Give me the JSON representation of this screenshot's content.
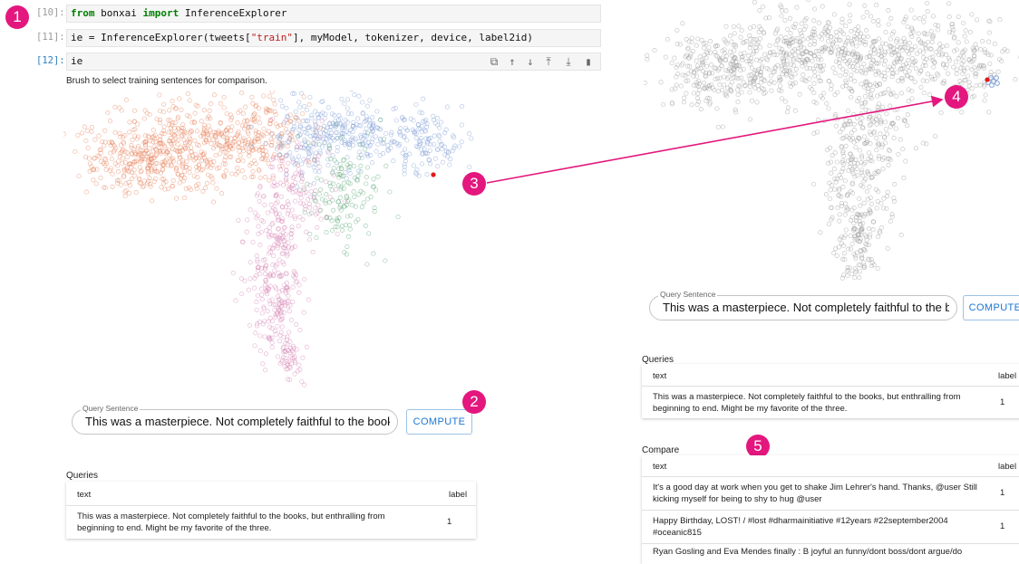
{
  "markers": {
    "m1": "1",
    "m2": "2",
    "m3": "3",
    "m4": "4",
    "m5": "5"
  },
  "cells": [
    {
      "prompt": "[10]:",
      "tokens": [
        {
          "t": "from",
          "c": "kw"
        },
        {
          "t": " bonxai ",
          "c": ""
        },
        {
          "t": "import",
          "c": "kw"
        },
        {
          "t": " InferenceExplorer",
          "c": ""
        }
      ]
    },
    {
      "prompt": "[11]:",
      "tokens": [
        {
          "t": "ie = InferenceExplorer(tweets[",
          "c": ""
        },
        {
          "t": "\"train\"",
          "c": "str"
        },
        {
          "t": "], myModel, tokenizer, device, label2id)",
          "c": ""
        }
      ]
    },
    {
      "prompt": "[12]:",
      "tokens": [
        {
          "t": "ie",
          "c": ""
        }
      ]
    }
  ],
  "toolbar_icons": [
    "copy-icon",
    "arrow-up-icon",
    "arrow-down-icon",
    "insert-above-icon",
    "insert-below-icon",
    "delete-icon"
  ],
  "brush_hint": "Brush to select training sentences for comparison.",
  "left": {
    "query_legend": "Query Sentence",
    "query_value": "This was a masterpiece. Not completely faithful to the books, but en",
    "compute_label": "COMPUTE",
    "queries_label": "Queries",
    "queries_table": {
      "headers": [
        "text",
        "label"
      ],
      "rows": [
        {
          "text1": "This was a masterpiece. Not completely faithful to the books, but enthralling from",
          "text2": "beginning to end. Might be my favorite of the three.",
          "label": "1"
        }
      ]
    }
  },
  "right": {
    "query_legend": "Query Sentence",
    "query_value": "This was a masterpiece. Not completely faithful to the books, but en",
    "compute_label": "COMPUTE",
    "queries_label": "Queries",
    "queries_table": {
      "headers": [
        "text",
        "label"
      ],
      "rows": [
        {
          "text1": "This was a masterpiece. Not completely faithful to the books, but enthralling from",
          "text2": "beginning to end. Might be my favorite of the three.",
          "label": "1"
        }
      ]
    },
    "compare_label": "Compare",
    "compare_table": {
      "headers": [
        "text",
        "label"
      ],
      "rows": [
        {
          "text1": "It's a good day at work when you get to shake Jim Lehrer's hand. Thanks, @user Still",
          "text2": "kicking myself for being to shy to hug @user",
          "label": "1"
        },
        {
          "text1": "Happy Birthday, LOST! / #lost #dharmainitiative #12years #22september2004",
          "text2": "#oceanic815",
          "label": "1"
        },
        {
          "text1": "Ryan Gosling and Eva Mendes finally : B joyful an funny/dont boss/dont argue/do",
          "text2": "",
          "label": ""
        }
      ]
    }
  },
  "colors": {
    "accent": "#e3177e",
    "orange": "#e8845c",
    "blue": "#7f9fd6",
    "green": "#5aa877",
    "pink": "#d783b5",
    "gray": "#9a9a9a",
    "red": "#e01b1b"
  }
}
